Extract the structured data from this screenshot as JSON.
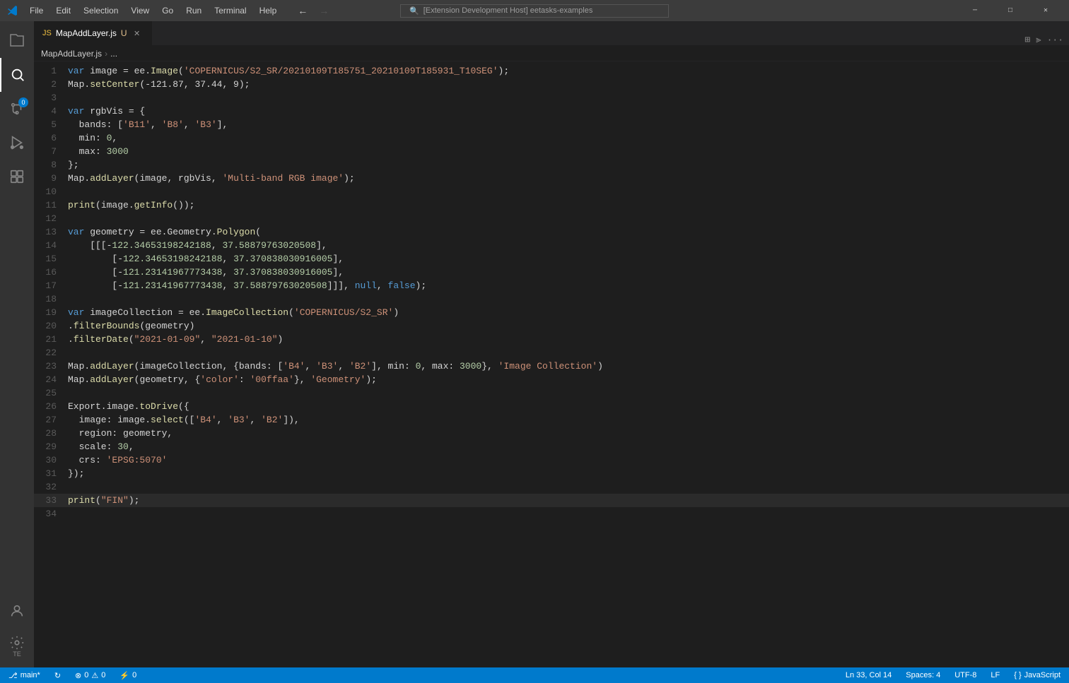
{
  "titleBar": {
    "appIcon": "VS",
    "menus": [
      "File",
      "Edit",
      "Selection",
      "View",
      "Go",
      "Run",
      "Terminal",
      "Help"
    ],
    "searchText": "[Extension Development Host] eetasks-examples",
    "searchIcon": "🔍",
    "navBack": "←",
    "navForward": "→",
    "winMinimize": "–",
    "winMaximize": "□",
    "winClose": "✕"
  },
  "activityBar": {
    "icons": [
      {
        "name": "explorer-icon",
        "symbol": "⎘",
        "active": false,
        "badge": null
      },
      {
        "name": "search-icon",
        "symbol": "🔍",
        "active": true,
        "badge": null
      },
      {
        "name": "source-control-icon",
        "symbol": "⑂",
        "active": false,
        "badge": "0"
      },
      {
        "name": "run-debug-icon",
        "symbol": "▷",
        "active": false,
        "badge": null
      },
      {
        "name": "extensions-icon",
        "symbol": "⊞",
        "active": false,
        "badge": null
      }
    ],
    "bottomIcons": [
      {
        "name": "accounts-icon",
        "symbol": "👤"
      },
      {
        "name": "settings-icon",
        "symbol": "⚙",
        "label": "TE"
      }
    ]
  },
  "tab": {
    "fileIcon": "JS",
    "filename": "MapAddLayer.js",
    "modified": true,
    "closeBtn": "✕"
  },
  "breadcrumb": {
    "file": "MapAddLayer.js",
    "separator": "›",
    "more": "..."
  },
  "lines": [
    {
      "num": 1,
      "tokens": [
        {
          "t": "kw",
          "v": "var"
        },
        {
          "t": "plain",
          "v": " image = ee."
        },
        {
          "t": "fn",
          "v": "Image"
        },
        {
          "t": "plain",
          "v": "("
        },
        {
          "t": "str",
          "v": "'COPERNICUS/S2_SR/20210109T185751_20210109T185931_T10SEG'"
        },
        {
          "t": "plain",
          "v": "};"
        }
      ]
    },
    {
      "num": 2,
      "tokens": [
        {
          "t": "plain",
          "v": "Map."
        },
        {
          "t": "fn",
          "v": "setCenter"
        },
        {
          "t": "plain",
          "v": "(-121.87, 37.44, 9);"
        }
      ]
    },
    {
      "num": 3,
      "tokens": []
    },
    {
      "num": 4,
      "tokens": [
        {
          "t": "kw",
          "v": "var"
        },
        {
          "t": "plain",
          "v": " rgbVis = {"
        }
      ]
    },
    {
      "num": 5,
      "tokens": [
        {
          "t": "plain",
          "v": "  bands: ["
        },
        {
          "t": "str",
          "v": "'B11'"
        },
        {
          "t": "plain",
          "v": ", "
        },
        {
          "t": "str",
          "v": "'B8'"
        },
        {
          "t": "plain",
          "v": ", "
        },
        {
          "t": "str",
          "v": "'B3'"
        },
        {
          "t": "plain",
          "v": "],"
        }
      ]
    },
    {
      "num": 6,
      "tokens": [
        {
          "t": "plain",
          "v": "  min: "
        },
        {
          "t": "num",
          "v": "0"
        },
        {
          "t": "plain",
          "v": ","
        }
      ]
    },
    {
      "num": 7,
      "tokens": [
        {
          "t": "plain",
          "v": "  max: "
        },
        {
          "t": "num",
          "v": "3000"
        }
      ]
    },
    {
      "num": 8,
      "tokens": [
        {
          "t": "plain",
          "v": "};"
        }
      ]
    },
    {
      "num": 9,
      "tokens": [
        {
          "t": "plain",
          "v": "Map."
        },
        {
          "t": "fn",
          "v": "addLayer"
        },
        {
          "t": "plain",
          "v": "(image, rgbVis, "
        },
        {
          "t": "str",
          "v": "'Multi-band RGB image'"
        },
        {
          "t": "plain",
          "v": ");"
        }
      ]
    },
    {
      "num": 10,
      "tokens": []
    },
    {
      "num": 11,
      "tokens": [
        {
          "t": "fn",
          "v": "print"
        },
        {
          "t": "plain",
          "v": "(image."
        },
        {
          "t": "fn",
          "v": "getInfo"
        },
        {
          "t": "plain",
          "v": "());"
        }
      ]
    },
    {
      "num": 12,
      "tokens": []
    },
    {
      "num": 13,
      "tokens": [
        {
          "t": "kw",
          "v": "var"
        },
        {
          "t": "plain",
          "v": " geometry = ee.Geometry."
        },
        {
          "t": "fn",
          "v": "Polygon"
        },
        {
          "t": "plain",
          "v": "("
        }
      ]
    },
    {
      "num": 14,
      "tokens": [
        {
          "t": "plain",
          "v": "  [[[-"
        },
        {
          "t": "num",
          "v": "122.34653198242188"
        },
        {
          "t": "plain",
          "v": ", "
        },
        {
          "t": "num",
          "v": "37.58879763020508"
        },
        {
          "t": "plain",
          "v": "],"
        }
      ]
    },
    {
      "num": 15,
      "tokens": [
        {
          "t": "plain",
          "v": "      [-"
        },
        {
          "t": "num",
          "v": "122.34653198242188"
        },
        {
          "t": "plain",
          "v": ", "
        },
        {
          "t": "num",
          "v": "37.370838030916005"
        },
        {
          "t": "plain",
          "v": "],"
        }
      ]
    },
    {
      "num": 16,
      "tokens": [
        {
          "t": "plain",
          "v": "      [-"
        },
        {
          "t": "num",
          "v": "121.23141967773438"
        },
        {
          "t": "plain",
          "v": ", "
        },
        {
          "t": "num",
          "v": "37.370838030916005"
        },
        {
          "t": "plain",
          "v": "],"
        }
      ]
    },
    {
      "num": 17,
      "tokens": [
        {
          "t": "plain",
          "v": "      [-"
        },
        {
          "t": "num",
          "v": "121.23141967773438"
        },
        {
          "t": "plain",
          "v": ", "
        },
        {
          "t": "num",
          "v": "37.58879763020508"
        },
        {
          "t": "plain",
          "v": "]]],  "
        },
        {
          "t": "kw",
          "v": "null"
        },
        {
          "t": "plain",
          "v": ", "
        },
        {
          "t": "kw",
          "v": "false"
        },
        {
          "t": "plain",
          "v": "};"
        }
      ]
    },
    {
      "num": 18,
      "tokens": []
    },
    {
      "num": 19,
      "tokens": [
        {
          "t": "kw",
          "v": "var"
        },
        {
          "t": "plain",
          "v": " imageCollection = ee."
        },
        {
          "t": "fn",
          "v": "ImageCollection"
        },
        {
          "t": "plain",
          "v": "("
        },
        {
          "t": "str",
          "v": "'COPERNICUS/S2_SR'"
        },
        {
          "t": "plain",
          "v": ")"
        }
      ]
    },
    {
      "num": 20,
      "tokens": [
        {
          "t": "plain",
          "v": "."
        },
        {
          "t": "fn",
          "v": "filterBounds"
        },
        {
          "t": "plain",
          "v": "(geometry)"
        }
      ]
    },
    {
      "num": 21,
      "tokens": [
        {
          "t": "plain",
          "v": "."
        },
        {
          "t": "fn",
          "v": "filterDate"
        },
        {
          "t": "plain",
          "v": "("
        },
        {
          "t": "str",
          "v": "\"2021-01-09\""
        },
        {
          "t": "plain",
          "v": ", "
        },
        {
          "t": "str",
          "v": "\"2021-01-10\""
        },
        {
          "t": "plain",
          "v": ")"
        }
      ]
    },
    {
      "num": 22,
      "tokens": []
    },
    {
      "num": 23,
      "tokens": [
        {
          "t": "plain",
          "v": "Map."
        },
        {
          "t": "fn",
          "v": "addLayer"
        },
        {
          "t": "plain",
          "v": "(imageCollection, {bands: ["
        },
        {
          "t": "str",
          "v": "'B4'"
        },
        {
          "t": "plain",
          "v": ", "
        },
        {
          "t": "str",
          "v": "'B3'"
        },
        {
          "t": "plain",
          "v": ", "
        },
        {
          "t": "str",
          "v": "'B2'"
        },
        {
          "t": "plain",
          "v": "], min: "
        },
        {
          "t": "num",
          "v": "0"
        },
        {
          "t": "plain",
          "v": ", max: "
        },
        {
          "t": "num",
          "v": "3000"
        },
        {
          "t": "plain",
          "v": "}, "
        },
        {
          "t": "str",
          "v": "'Image Collection'"
        },
        {
          "t": "plain",
          "v": ")"
        }
      ]
    },
    {
      "num": 24,
      "tokens": [
        {
          "t": "plain",
          "v": "Map."
        },
        {
          "t": "fn",
          "v": "addLayer"
        },
        {
          "t": "plain",
          "v": "(geometry, {"
        },
        {
          "t": "str",
          "v": "'color'"
        },
        {
          "t": "plain",
          "v": ": "
        },
        {
          "t": "str",
          "v": "'00ffaa'"
        },
        {
          "t": "plain",
          "v": "}, "
        },
        {
          "t": "str",
          "v": "'Geometry'"
        },
        {
          "t": "plain",
          "v": ");"
        }
      ]
    },
    {
      "num": 25,
      "tokens": []
    },
    {
      "num": 26,
      "tokens": [
        {
          "t": "plain",
          "v": "Export.image."
        },
        {
          "t": "fn",
          "v": "toDrive"
        },
        {
          "t": "plain",
          "v": "({"
        }
      ]
    },
    {
      "num": 27,
      "tokens": [
        {
          "t": "plain",
          "v": "  image: image."
        },
        {
          "t": "fn",
          "v": "select"
        },
        {
          "t": "plain",
          "v": "(["
        },
        {
          "t": "str",
          "v": "'B4'"
        },
        {
          "t": "plain",
          "v": ", "
        },
        {
          "t": "str",
          "v": "'B3'"
        },
        {
          "t": "plain",
          "v": ", "
        },
        {
          "t": "str",
          "v": "'B2'"
        },
        {
          "t": "plain",
          "v": "]),"
        }
      ]
    },
    {
      "num": 28,
      "tokens": [
        {
          "t": "plain",
          "v": "  region: geometry,"
        }
      ]
    },
    {
      "num": 29,
      "tokens": [
        {
          "t": "plain",
          "v": "  scale: "
        },
        {
          "t": "num",
          "v": "30"
        },
        {
          "t": "plain",
          "v": ","
        }
      ]
    },
    {
      "num": 30,
      "tokens": [
        {
          "t": "plain",
          "v": "  crs: "
        },
        {
          "t": "str",
          "v": "'EPSG:5070'"
        }
      ]
    },
    {
      "num": 31,
      "tokens": [
        {
          "t": "plain",
          "v": "});"
        }
      ]
    },
    {
      "num": 32,
      "tokens": []
    },
    {
      "num": 33,
      "tokens": [
        {
          "t": "fn",
          "v": "print"
        },
        {
          "t": "plain",
          "v": "("
        },
        {
          "t": "str",
          "v": "\"FIN\""
        },
        {
          "t": "plain",
          "v": ");"
        }
      ],
      "current": true
    },
    {
      "num": 34,
      "tokens": []
    }
  ],
  "statusBar": {
    "branch": "main*",
    "syncIcon": "↻",
    "errorsCount": "0",
    "warningsCount": "0",
    "portsCount": "0",
    "position": "Ln 33, Col 14",
    "spaces": "Spaces: 4",
    "encoding": "UTF-8",
    "lineEnding": "LF",
    "language": "JavaScript"
  }
}
